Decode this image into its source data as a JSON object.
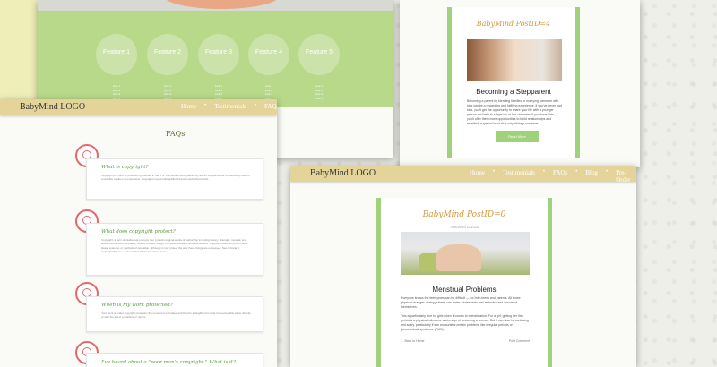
{
  "colors": {
    "accent_green": "#9fd27a",
    "nav_tan": "#e5d49a",
    "feature_green": "#b8d98a",
    "icon_red": "#e06a6a",
    "title_gold": "#d19a3a"
  },
  "features": [
    {
      "label": "Feature 1",
      "list": [
        "Line 1",
        "Line 2",
        "Line 3",
        "Line 4"
      ]
    },
    {
      "label": "Feature 2",
      "list": [
        "Line 1",
        "Line 2",
        "Line 3",
        "Line 4"
      ]
    },
    {
      "label": "Feature 3",
      "list": [
        "Line 1",
        "Line 2",
        "Line 3",
        "Line 4"
      ]
    },
    {
      "label": "Feature 4",
      "list": [
        "Line 1",
        "Line 2",
        "Line 3",
        "Line 4"
      ]
    },
    {
      "label": "Feature 5",
      "list": [
        "Line 1",
        "Line 2",
        "Line 3",
        "Line 4"
      ]
    }
  ],
  "post4": {
    "title": "BabyMind PostID=4",
    "headline": "Becoming a Stepparent",
    "body": "Becoming a parent by blending families or marrying someone with kids can be a rewarding and fulfilling experience. If you've never had kids, you'll get the opportunity to share your life with a younger person and help to shape his or her character. If you have kids, you'll offer them more opportunities to build relationships and establish a special bond that only siblings can have.",
    "button": "Read More"
  },
  "nav": {
    "logo": "BabyMind LOGO",
    "items": [
      "Home",
      "Testimonials",
      "FAQs",
      "Blog",
      "Pre-Order"
    ]
  },
  "faq": {
    "title": "FAQs",
    "items": [
      {
        "q": "What is copyright?",
        "a": "Copyright is a form of protection grounded in the U.S. Constitution and granted by law for original works of authorship fixed in a tangible medium of expression. Copyright covers both published and unpublished works."
      },
      {
        "q": "What does copyright protect?",
        "a": "Copyright, a form of intellectual property law, protects original works of authorship including literary, dramatic, musical, and artistic works, such as poetry, novels, movies, songs, computer software, and architecture. Copyright does not protect facts, ideas, systems, or methods of operation, although it may protect the way these things are expressed. See Circular 1, Copyright Basics, section 'What Works Are Protected.'"
      },
      {
        "q": "When is my work protected?",
        "a": "Your work is under copyright protection the moment it is created and fixed in a tangible form that it is perceptible either directly or with the aid of a machine or device."
      },
      {
        "q": "I've heard about a \"poor man's copyright.\" What is it?",
        "a": ""
      }
    ]
  },
  "post0": {
    "title": "BabyMind PostID=0",
    "meta": "- 2019-2019 0 comments",
    "headline": "Menstrual Problems",
    "body1": "Everyone knows the teen years can be difficult — for both teens and parents. All those physical changes during puberty can make adolescents feel awkward and unsure of themselves.",
    "body2": "This is particularly true for girls when it comes to menstruation. For a girl, getting her first period is a physical milestone and a sign of becoming a woman. But it can also be confusing and scary, particularly if she encounters certain problems like irregular periods or premenstrual syndrome (PMS).",
    "back": "← Back to Home",
    "post_comment": "Post Comment"
  }
}
